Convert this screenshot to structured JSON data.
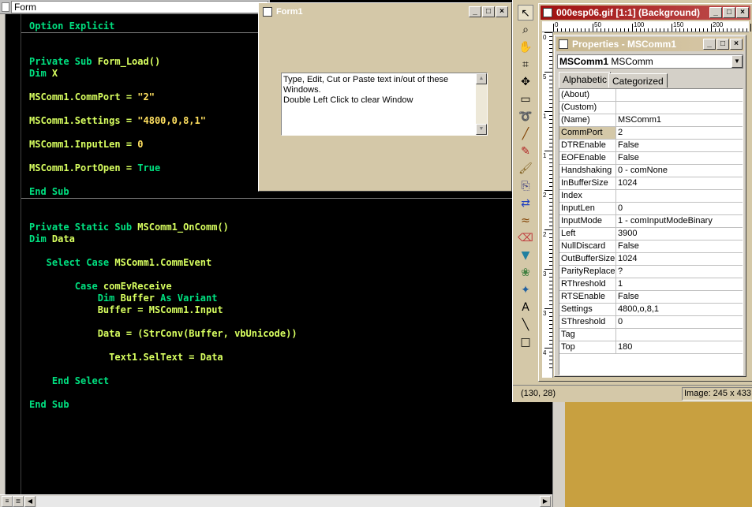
{
  "editor": {
    "object_combo": "Form",
    "lines": [
      {
        "segments": [
          {
            "t": "Option Explicit",
            "c": "kw"
          }
        ]
      },
      {
        "segments": [
          {
            "t": "Private Sub ",
            "c": "kw"
          },
          {
            "t": "Form_Load()",
            "c": "tx"
          }
        ]
      },
      {
        "segments": [
          {
            "t": "Dim ",
            "c": "kw"
          },
          {
            "t": "X",
            "c": "tx"
          }
        ]
      },
      {
        "segments": [
          {
            "t": "MSComm1.CommPort = ",
            "c": "tx"
          },
          {
            "t": "\"2\"",
            "c": "num"
          }
        ]
      },
      {
        "segments": [
          {
            "t": "MSComm1.Settings = ",
            "c": "tx"
          },
          {
            "t": "\"4800,0,8,1\"",
            "c": "num"
          }
        ]
      },
      {
        "segments": [
          {
            "t": "MSComm1.InputLen = ",
            "c": "tx"
          },
          {
            "t": "0",
            "c": "num"
          }
        ]
      },
      {
        "segments": [
          {
            "t": "MSComm1.PortOpen = ",
            "c": "tx"
          },
          {
            "t": "True",
            "c": "kw"
          }
        ]
      },
      {
        "segments": [
          {
            "t": "End Sub",
            "c": "kw"
          }
        ]
      },
      {
        "segments": [
          {
            "t": "Private Static Sub ",
            "c": "kw"
          },
          {
            "t": "MSComm1_OnComm()",
            "c": "tx"
          }
        ]
      },
      {
        "segments": [
          {
            "t": "Dim ",
            "c": "kw"
          },
          {
            "t": "Data",
            "c": "tx"
          }
        ]
      },
      {
        "segments": [
          {
            "t": "   Select Case ",
            "c": "kw"
          },
          {
            "t": "MSComm1.CommEvent",
            "c": "tx"
          }
        ]
      },
      {
        "segments": [
          {
            "t": "        Case ",
            "c": "kw"
          },
          {
            "t": "comEvReceive",
            "c": "tx"
          }
        ]
      },
      {
        "segments": [
          {
            "t": "            Dim ",
            "c": "kw"
          },
          {
            "t": "Buffer ",
            "c": "tx"
          },
          {
            "t": "As Variant",
            "c": "kw"
          }
        ]
      },
      {
        "segments": [
          {
            "t": "            Buffer = MSComm1.Input",
            "c": "tx"
          }
        ]
      },
      {
        "segments": [
          {
            "t": "            Data = (StrConv(Buffer, vbUnicode))",
            "c": "tx"
          }
        ]
      },
      {
        "segments": [
          {
            "t": "              Text1.SelText = Data",
            "c": "tx"
          }
        ]
      },
      {
        "segments": [
          {
            "t": "    End Select",
            "c": "kw"
          }
        ]
      },
      {
        "segments": [
          {
            "t": "End Sub",
            "c": "kw"
          }
        ]
      }
    ]
  },
  "form1": {
    "title": "Form1",
    "textbox_lines": [
      "Type, Edit, Cut or Paste text in/out of these",
      "Windows.",
      "Double Left Click to clear Window"
    ]
  },
  "image_window": {
    "title": "000esp06.gif [1:1] (Background)",
    "ruler_top": [
      "0",
      "50",
      "100",
      "150",
      "200"
    ],
    "ruler_left": [
      "0",
      "5",
      "1",
      "1",
      "2",
      "2",
      "3",
      "3",
      "4"
    ]
  },
  "properties": {
    "title": "Properties - MSComm1",
    "object_name": "MSComm1",
    "object_type": "MSComm",
    "tabs": [
      "Alphabetic",
      "Categorized"
    ],
    "rows": [
      {
        "name": "(About)",
        "value": ""
      },
      {
        "name": "(Custom)",
        "value": ""
      },
      {
        "name": "(Name)",
        "value": "MSComm1"
      },
      {
        "name": "CommPort",
        "value": "2",
        "selected": true
      },
      {
        "name": "DTREnable",
        "value": "False"
      },
      {
        "name": "EOFEnable",
        "value": "False"
      },
      {
        "name": "Handshaking",
        "value": "0 - comNone"
      },
      {
        "name": "InBufferSize",
        "value": "1024"
      },
      {
        "name": "Index",
        "value": ""
      },
      {
        "name": "InputLen",
        "value": "0"
      },
      {
        "name": "InputMode",
        "value": "1 - comInputModeBinary"
      },
      {
        "name": "Left",
        "value": "3900"
      },
      {
        "name": "NullDiscard",
        "value": "False"
      },
      {
        "name": "OutBufferSize",
        "value": "1024"
      },
      {
        "name": "ParityReplace",
        "value": "?"
      },
      {
        "name": "RThreshold",
        "value": "1"
      },
      {
        "name": "RTSEnable",
        "value": "False"
      },
      {
        "name": "Settings",
        "value": "4800,o,8,1"
      },
      {
        "name": "SThreshold",
        "value": "0"
      },
      {
        "name": "Tag",
        "value": ""
      },
      {
        "name": "Top",
        "value": "180"
      }
    ]
  },
  "status": {
    "coords": "(130, 28)",
    "image_size": "Image:  245 x 433"
  },
  "tools": [
    "pointer-tool-icon",
    "zoom-tool-icon",
    "pan-tool-icon",
    "crop-tool-icon",
    "move-tool-icon",
    "rectangle-select-icon",
    "lasso-select-icon",
    "pen-tool-icon",
    "dropper-tool-icon",
    "brush-tool-icon",
    "clone-tool-icon",
    "color-replace-icon",
    "scratch-remover-icon",
    "eraser-tool-icon",
    "fill-tool-icon",
    "picture-tube-icon",
    "retouch-tool-icon",
    "text-tool-icon",
    "line-tool-icon",
    "shape-tool-icon"
  ]
}
